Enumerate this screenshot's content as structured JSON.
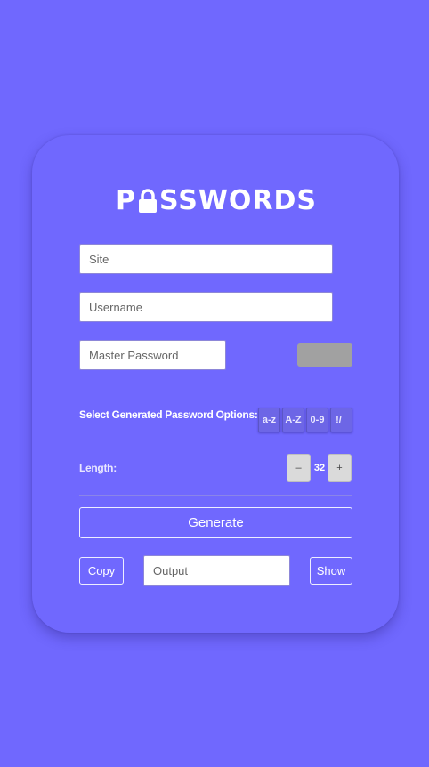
{
  "app": {
    "logo_text": "PASSWORDS"
  },
  "form": {
    "site_placeholder": "Site",
    "username_placeholder": "Username",
    "master_password_placeholder": "Master Password"
  },
  "options": {
    "label": "Select Generated Password Options:",
    "lowercase": "a-z",
    "uppercase": "A-Z",
    "digits": "0-9",
    "symbols": "!/_"
  },
  "length": {
    "label": "Length:",
    "decrement": "–",
    "value": "32",
    "increment": "+"
  },
  "actions": {
    "generate": "Generate",
    "copy": "Copy",
    "output_placeholder": "Output",
    "show": "Show"
  },
  "colors": {
    "background": "#7068fe",
    "card": "#7068fe",
    "gray_button": "#a1a1a1"
  }
}
